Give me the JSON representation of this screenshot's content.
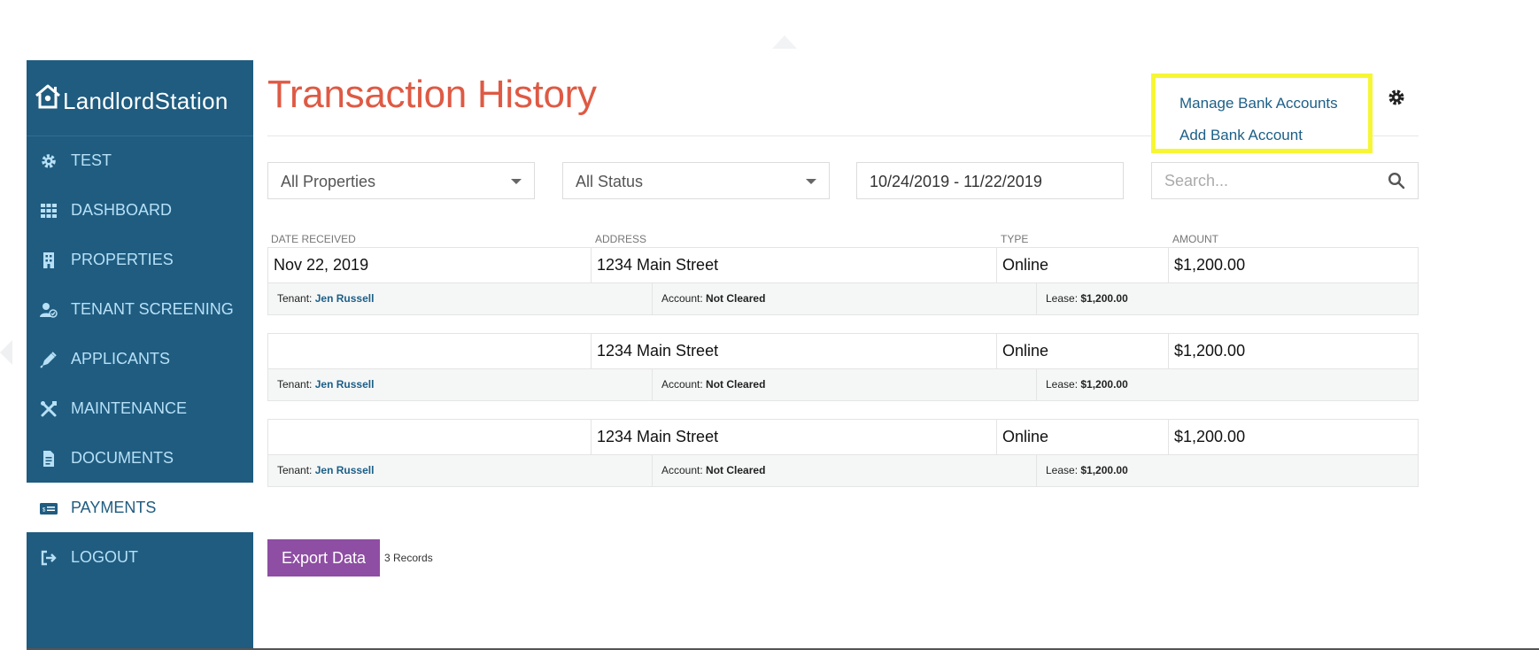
{
  "brand": {
    "name": "LandlordStation"
  },
  "sidebar": {
    "items": [
      {
        "label": "TEST",
        "icon": "gear-icon"
      },
      {
        "label": "DASHBOARD",
        "icon": "grid-icon"
      },
      {
        "label": "PROPERTIES",
        "icon": "building-icon"
      },
      {
        "label": "TENANT SCREENING",
        "icon": "user-check-icon"
      },
      {
        "label": "APPLICANTS",
        "icon": "pen-icon"
      },
      {
        "label": "MAINTENANCE",
        "icon": "tools-icon"
      },
      {
        "label": "DOCUMENTS",
        "icon": "document-icon"
      },
      {
        "label": "PAYMENTS",
        "icon": "payment-card-icon",
        "active": true
      },
      {
        "label": "LOGOUT",
        "icon": "logout-icon"
      }
    ]
  },
  "page": {
    "title": "Transaction History"
  },
  "menu": {
    "manage_bank": "Manage Bank Accounts",
    "add_bank": "Add Bank Account"
  },
  "filters": {
    "property": "All Properties",
    "status": "All Status",
    "date_range": "10/24/2019 - 11/22/2019",
    "search_placeholder": "Search..."
  },
  "table": {
    "headers": [
      "DATE RECEIVED",
      "ADDRESS",
      "TYPE",
      "AMOUNT"
    ],
    "rows": [
      {
        "date": "Nov 22, 2019",
        "address": "1234 Main Street",
        "type": "Online",
        "amount": "$1,200.00",
        "tenant_label": "Tenant:",
        "tenant": "Jen Russell",
        "account_label": "Account:",
        "account": "Not Cleared",
        "lease_label": "Lease:",
        "lease": "$1,200.00"
      },
      {
        "date": "",
        "address": "1234 Main Street",
        "type": "Online",
        "amount": "$1,200.00",
        "tenant_label": "Tenant:",
        "tenant": "Jen Russell",
        "account_label": "Account:",
        "account": "Not Cleared",
        "lease_label": "Lease:",
        "lease": "$1,200.00"
      },
      {
        "date": "",
        "address": "1234 Main Street",
        "type": "Online",
        "amount": "$1,200.00",
        "tenant_label": "Tenant:",
        "tenant": "Jen Russell",
        "account_label": "Account:",
        "account": "Not Cleared",
        "lease_label": "Lease:",
        "lease": "$1,200.00"
      }
    ]
  },
  "footer": {
    "export_label": "Export Data",
    "records": "3 Records"
  },
  "colors": {
    "sidebar_bg": "#1f5c80",
    "sidebar_text": "#b7e0f6",
    "title": "#de5a44",
    "export_button": "#8e4ea3",
    "link": "#1c5f87",
    "highlight_border": "#f6f634"
  }
}
